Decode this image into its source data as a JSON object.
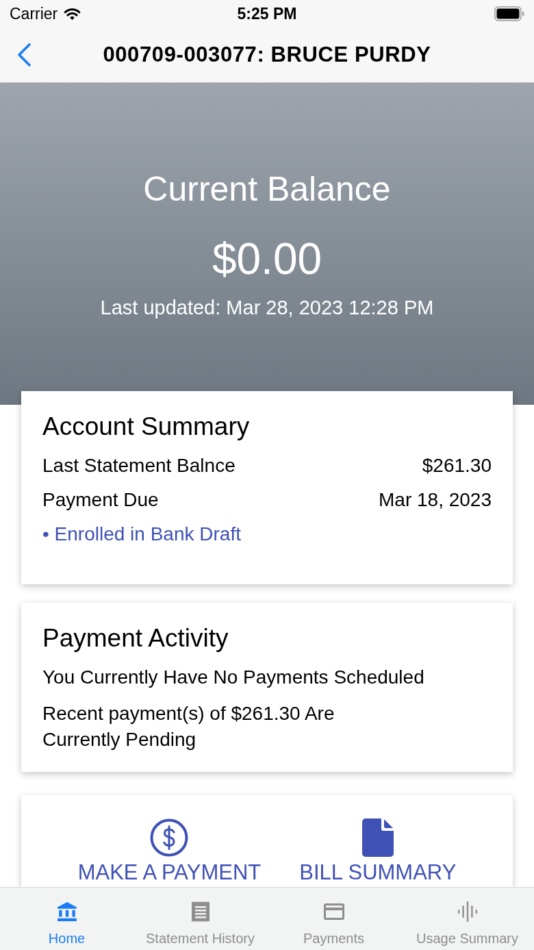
{
  "status_bar": {
    "carrier": "Carrier",
    "time": "5:25 PM"
  },
  "nav_bar": {
    "title": "000709-003077: BRUCE PURDY"
  },
  "balance": {
    "title": "Current Balance",
    "amount": "$0.00",
    "updated": "Last updated: Mar 28, 2023 12:28 PM"
  },
  "account_summary": {
    "title": "Account Summary",
    "rows": [
      {
        "label": "Last Statement Balnce",
        "value": "$261.30"
      },
      {
        "label": "Payment Due",
        "value": "Mar 18, 2023"
      }
    ],
    "notes": [
      "• Enrolled in Bank Draft"
    ]
  },
  "payment_activity": {
    "title": "Payment Activity",
    "lines": [
      "You Currently Have No Payments Scheduled",
      "Recent payment(s) of $261.30 Are Currently Pending"
    ]
  },
  "actions": [
    {
      "kind": "payment",
      "label": "MAKE A PAYMENT"
    },
    {
      "kind": "bill",
      "label": "BILL SUMMARY"
    }
  ],
  "tab_bar": [
    {
      "kind": "home",
      "label": "Home",
      "selected": true
    },
    {
      "kind": "statements",
      "label": "Statement History",
      "selected": false
    },
    {
      "kind": "payments",
      "label": "Payments",
      "selected": false
    },
    {
      "kind": "usage",
      "label": "Usage Summary",
      "selected": false
    }
  ]
}
